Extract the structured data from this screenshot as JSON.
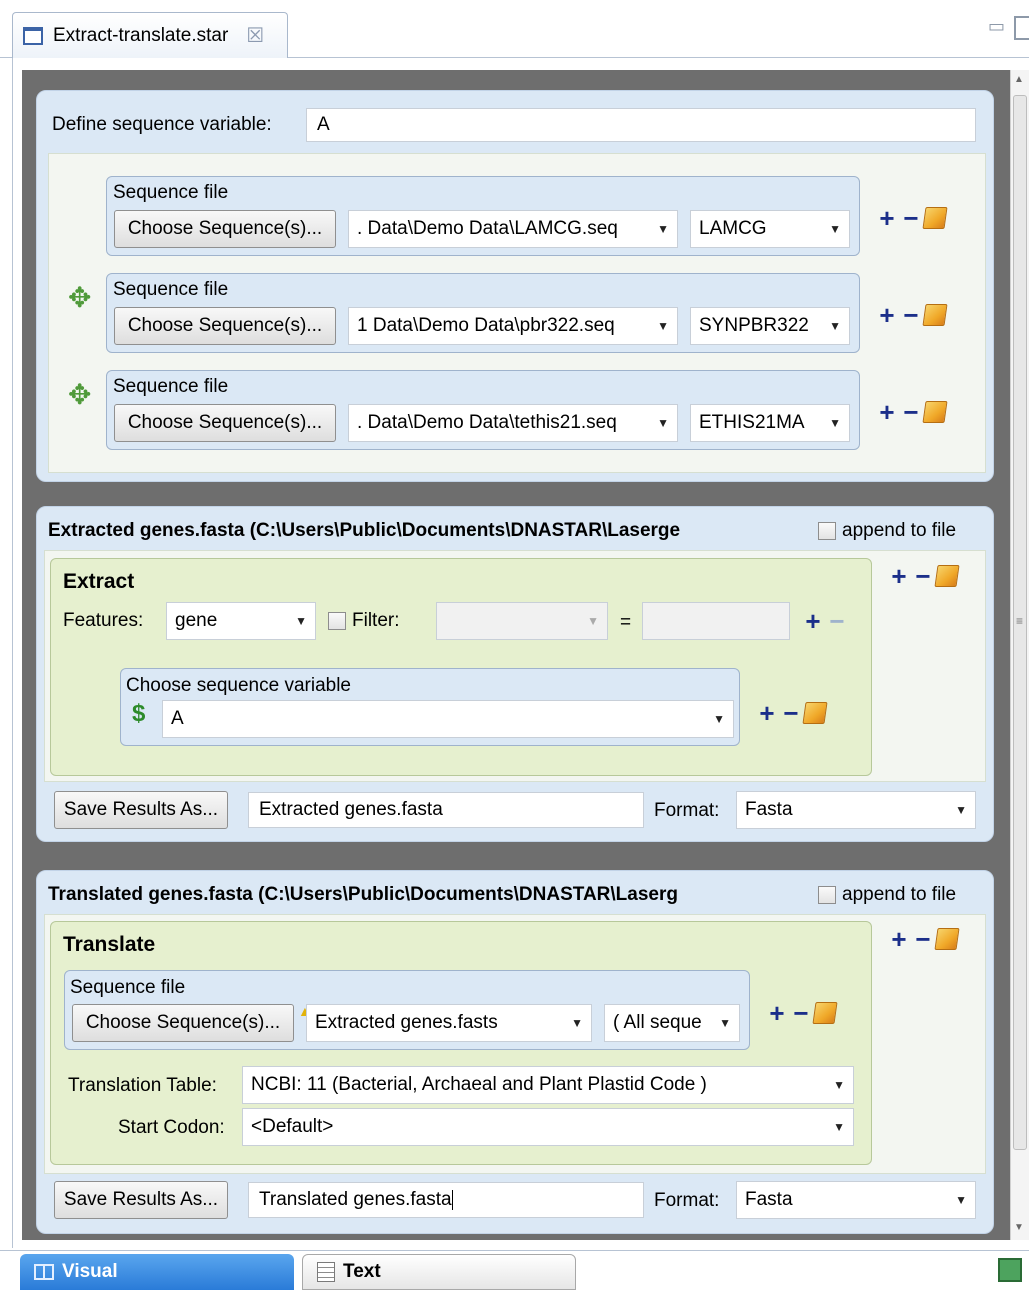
{
  "editor_tab": {
    "title": "Extract-translate.star",
    "close": "☒"
  },
  "define": {
    "label": "Define sequence variable:",
    "value": "A",
    "rows": [
      {
        "title": "Sequence file",
        "button": "Choose Sequence(s)...",
        "path": ". Data\\Demo Data\\LAMCG.seq",
        "seq": "LAMCG"
      },
      {
        "title": "Sequence file",
        "button": "Choose Sequence(s)...",
        "path": "1 Data\\Demo Data\\pbr322.seq",
        "seq": "SYNPBR322"
      },
      {
        "title": "Sequence file",
        "button": "Choose Sequence(s)...",
        "path": ". Data\\Demo Data\\tethis21.seq",
        "seq": "ETHIS21MA"
      }
    ]
  },
  "extract_section": {
    "header": "Extracted genes.fasta  (C:\\Users\\Public\\Documents\\DNASTAR\\Lasergе",
    "append_label": "append to file",
    "box_title": "Extract",
    "features_label": "Features:",
    "features_value": "gene",
    "filter_label": "Filter:",
    "equals": "=",
    "filter_value": "",
    "choose_var_label": "Choose sequence variable",
    "var_value": "A",
    "save_button": "Save Results As...",
    "output_file": "Extracted genes.fasta",
    "format_label": "Format:",
    "format_value": "Fasta"
  },
  "translate_section": {
    "header": "Translated genes.fasta  (C:\\Users\\Public\\Documents\\DNASTAR\\Laserɡ",
    "append_label": "append to file",
    "box_title": "Translate",
    "seq_title": "Sequence file",
    "choose_button": "Choose Sequence(s)...",
    "source_file": "Extracted genes.fasts",
    "seq_select": "( All seque",
    "table_label": "Translation Table:",
    "table_value": "NCBI: 11 (Bacterial, Archaeal and Plant Plastid Code )",
    "start_label": "Start Codon:",
    "start_value": "<Default>",
    "save_button": "Save Results As...",
    "output_file": "Translated genes.fasta",
    "format_label": "Format:",
    "format_value": "Fasta"
  },
  "bottom_tabs": {
    "visual": "Visual",
    "text": "Text"
  },
  "icons": {
    "plus": "+",
    "minus": "−",
    "move": "✥",
    "dollar": "$",
    "warning": "▲",
    "arrow": "▼"
  }
}
